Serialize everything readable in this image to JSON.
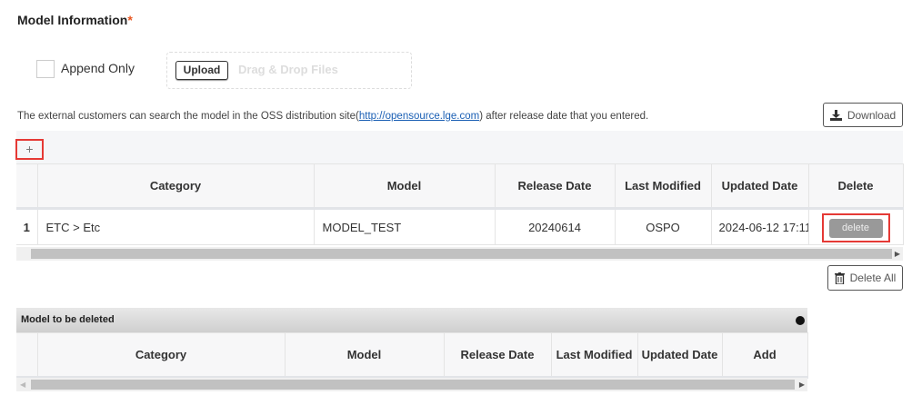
{
  "section": {
    "title": "Model Information",
    "required_mark": "*"
  },
  "append_only": {
    "label": "Append Only",
    "checked": false
  },
  "upload": {
    "button": "Upload",
    "drop_text": "Drag & Drop Files"
  },
  "info": {
    "before": "The external customers can search the model in the OSS distribution site(",
    "link": "http://opensource.lge.com",
    "after": ") after release date that you entered."
  },
  "buttons": {
    "download": "Download",
    "add": "+",
    "delete_all": "Delete All"
  },
  "model_table": {
    "columns": [
      "",
      "Category",
      "Model",
      "Release Date",
      "Last Modified",
      "Updated Date",
      "Delete"
    ],
    "rows": [
      {
        "num": "1",
        "category": "ETC > Etc",
        "model": "MODEL_TEST",
        "release_date": "20240614",
        "last_modified": "OSPO",
        "updated_date": "2024-06-12 17:11",
        "delete": "delete"
      }
    ]
  },
  "deleted_panel": {
    "title": "Model to be deleted",
    "columns": [
      "",
      "Category",
      "Model",
      "Release Date",
      "Last Modified",
      "Updated Date",
      "Add"
    ]
  }
}
